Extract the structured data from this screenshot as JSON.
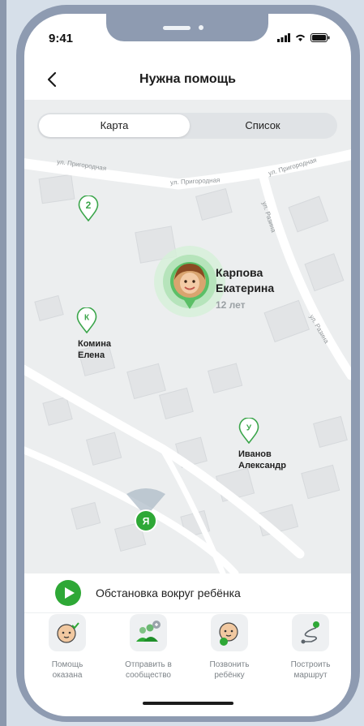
{
  "status_bar": {
    "time": "9:41"
  },
  "header": {
    "title": "Нужна помощь"
  },
  "tabs": {
    "map": "Карта",
    "list": "Список"
  },
  "map": {
    "streets": [
      "ул. Пригородная",
      "ул. Пригородная",
      "ул. Пригородная",
      "ул. Разина",
      "ул. Разина"
    ],
    "cluster": {
      "count": "2"
    },
    "main_person": {
      "name_line1": "Карпова",
      "name_line2": "Екатерина",
      "age": "12 лет"
    },
    "people": [
      {
        "initial": "К",
        "line1": "Комина",
        "line2": "Елена"
      },
      {
        "initial": "У",
        "line1": "Иванов",
        "line2": "Александр"
      }
    ],
    "me_label": "Я"
  },
  "info_bar": {
    "text": "Обстановка вокруг ребёнка"
  },
  "actions": [
    {
      "icon": "child-check-icon",
      "line1": "Помощь",
      "line2": "оказана"
    },
    {
      "icon": "community-icon",
      "line1": "Отправить в",
      "line2": "сообщество"
    },
    {
      "icon": "call-child-icon",
      "line1": "Позвонить",
      "line2": "ребёнку"
    },
    {
      "icon": "route-icon",
      "line1": "Построить",
      "line2": "маршрут"
    }
  ],
  "colors": {
    "accent": "#2ea836",
    "frame": "#8e9bb1",
    "map_bg": "#eceeef"
  }
}
